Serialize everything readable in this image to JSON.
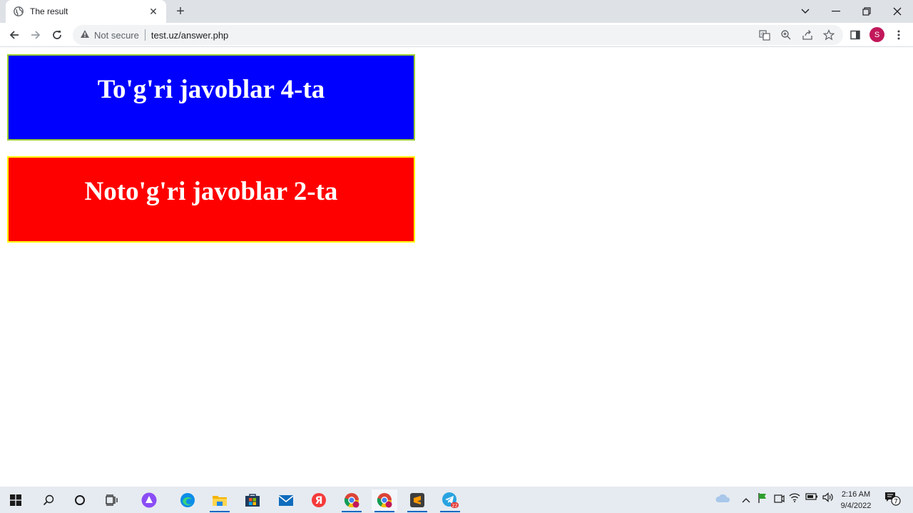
{
  "browser": {
    "tab_title": "The result",
    "new_tab": "+",
    "omnibox": {
      "security_label": "Not secure",
      "url": "test.uz/answer.php"
    },
    "profile_initial": "S"
  },
  "results": {
    "correct_label": "To'g'ri javoblar 4-ta",
    "wrong_label": "Noto'g'ri javoblar 2-ta",
    "correct_bg": "#0000ff",
    "wrong_bg": "#ff0000"
  },
  "taskbar": {
    "time": "2:16 AM",
    "date": "9/4/2022",
    "telegram_badge": "22",
    "notification_count": "7",
    "search_button": "Я"
  }
}
